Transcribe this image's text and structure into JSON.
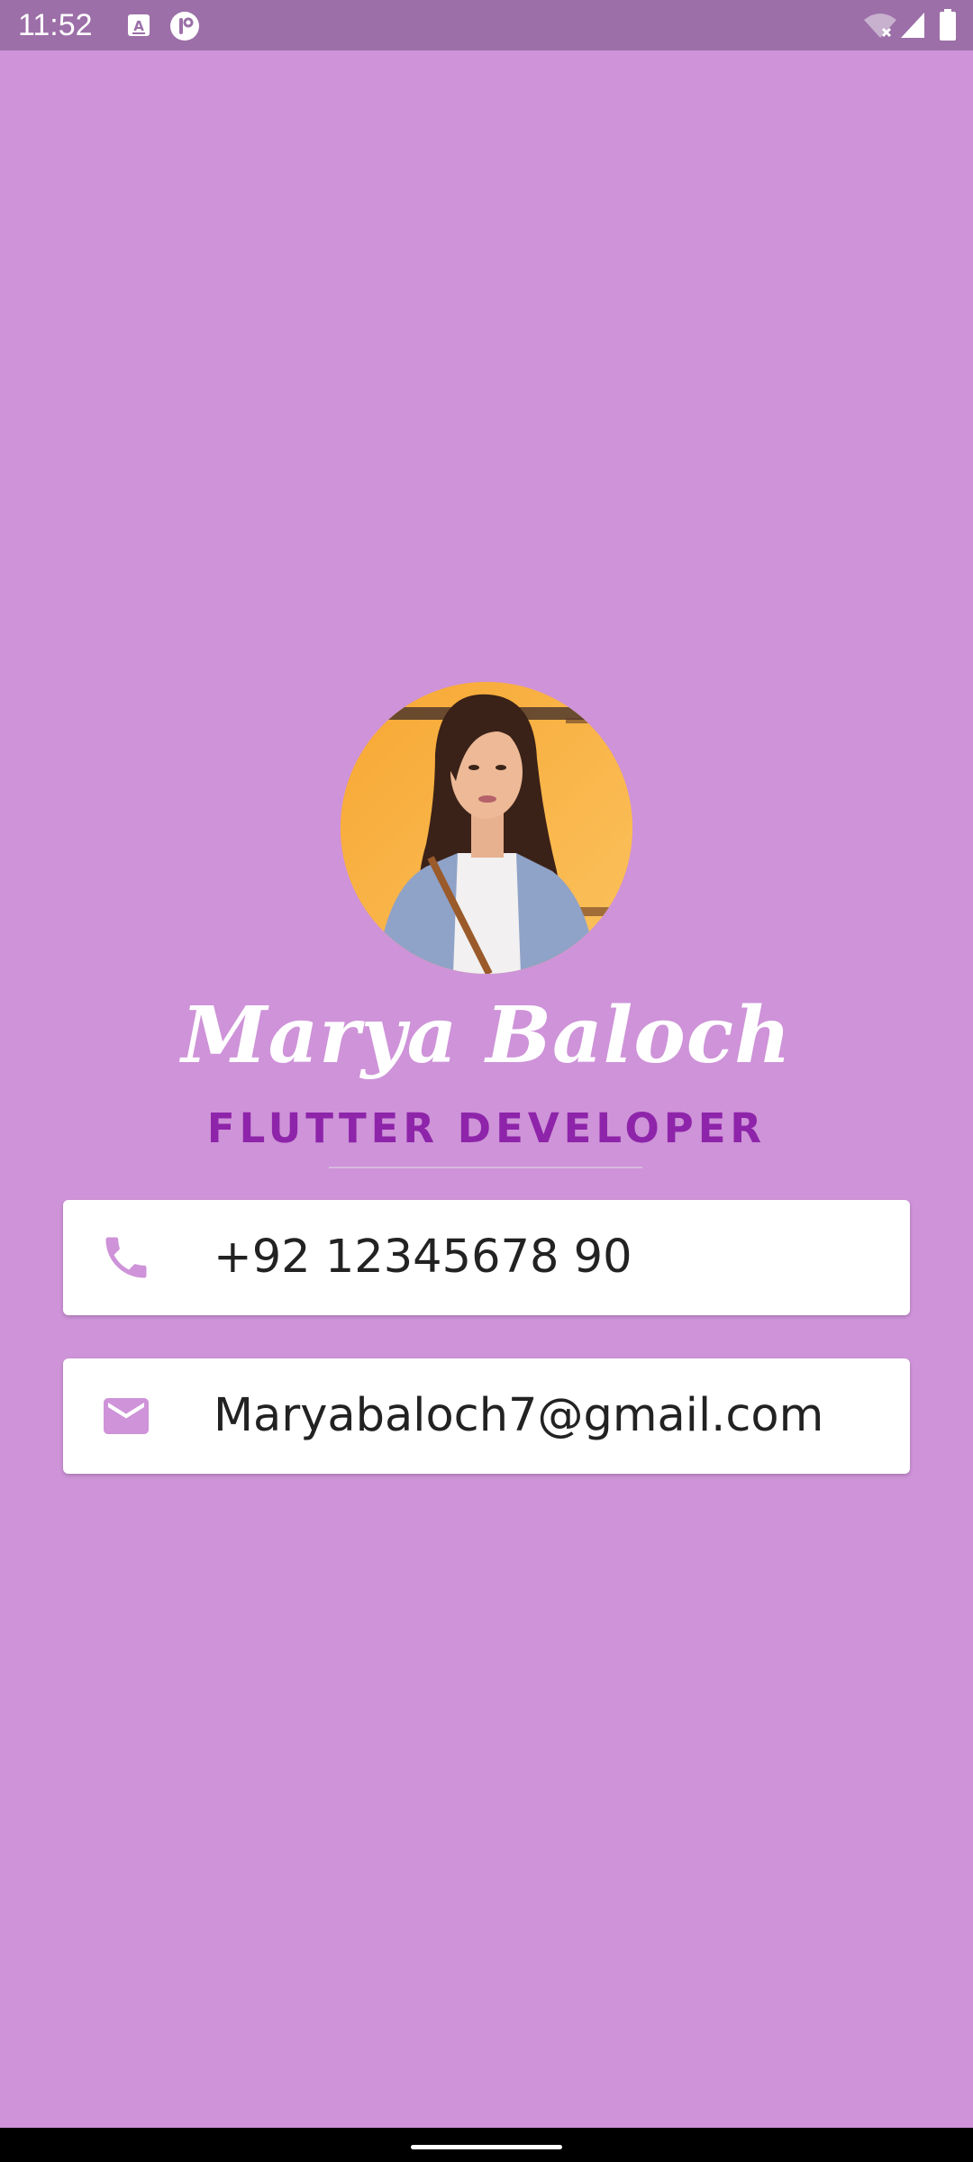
{
  "status_bar": {
    "time": "11:52",
    "left_icons": [
      "keyboard-a-icon",
      "notification-app-icon"
    ],
    "right_icons": [
      "wifi-off-icon",
      "signal-icon",
      "battery-icon"
    ]
  },
  "profile": {
    "name": "Marya Baloch",
    "role": "FLUTTER DEVELOPER",
    "avatar": "profile-photo"
  },
  "contacts": {
    "phone": "+92 12345678 90",
    "email": "Maryabaloch7@gmail.com"
  },
  "colors": {
    "background": "#CE93D8",
    "status_bar": "#9C6FA8",
    "role_text": "#8E24AA",
    "icon": "#CE93D8",
    "card": "#FFFFFF"
  }
}
